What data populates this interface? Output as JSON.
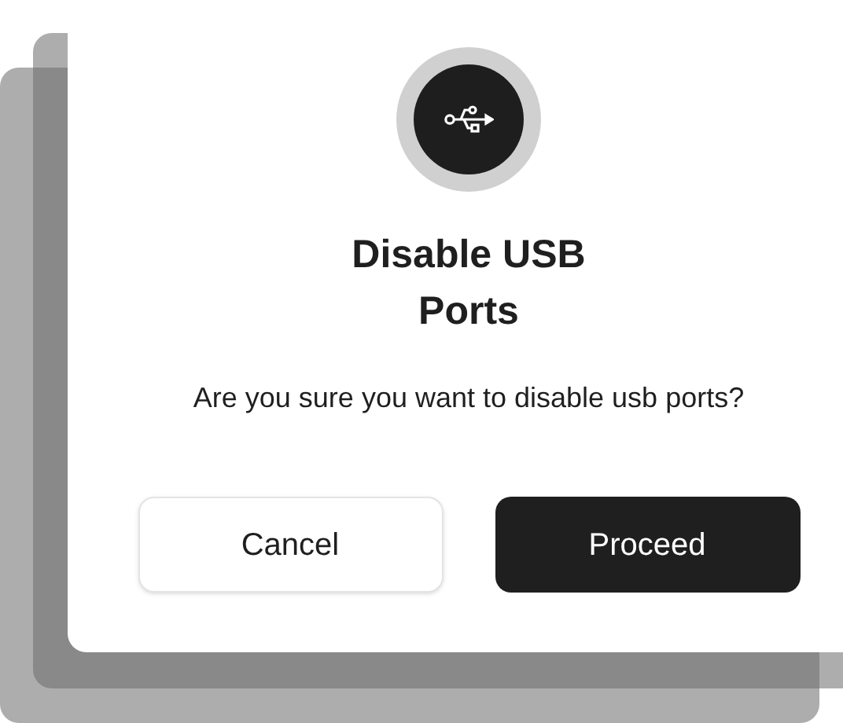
{
  "dialog": {
    "title": "Disable USB Ports",
    "message": "Are you sure you want to disable usb ports?",
    "buttons": [
      {
        "label": "Cancel",
        "kind": "secondary"
      },
      {
        "label": "Proceed",
        "kind": "primary"
      }
    ]
  }
}
